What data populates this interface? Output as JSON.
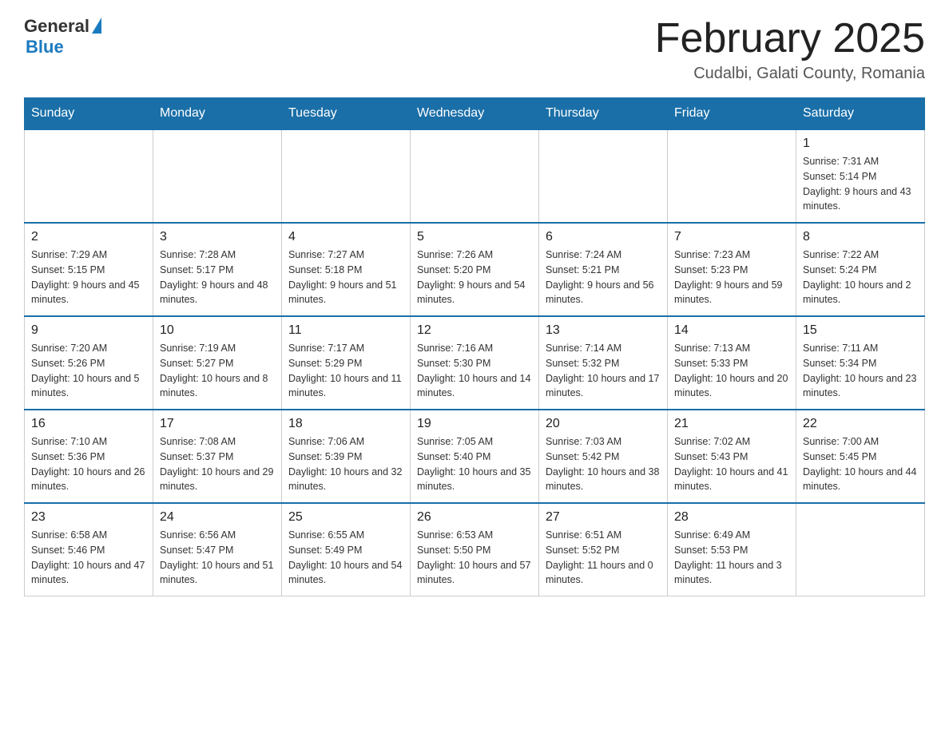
{
  "logo": {
    "general": "General",
    "blue": "Blue"
  },
  "title": "February 2025",
  "location": "Cudalbi, Galati County, Romania",
  "days_of_week": [
    "Sunday",
    "Monday",
    "Tuesday",
    "Wednesday",
    "Thursday",
    "Friday",
    "Saturday"
  ],
  "weeks": [
    {
      "days": [
        {
          "date": "",
          "empty": true
        },
        {
          "date": "",
          "empty": true
        },
        {
          "date": "",
          "empty": true
        },
        {
          "date": "",
          "empty": true
        },
        {
          "date": "",
          "empty": true
        },
        {
          "date": "",
          "empty": true
        },
        {
          "date": "1",
          "sunrise": "Sunrise: 7:31 AM",
          "sunset": "Sunset: 5:14 PM",
          "daylight": "Daylight: 9 hours and 43 minutes."
        }
      ]
    },
    {
      "days": [
        {
          "date": "2",
          "sunrise": "Sunrise: 7:29 AM",
          "sunset": "Sunset: 5:15 PM",
          "daylight": "Daylight: 9 hours and 45 minutes."
        },
        {
          "date": "3",
          "sunrise": "Sunrise: 7:28 AM",
          "sunset": "Sunset: 5:17 PM",
          "daylight": "Daylight: 9 hours and 48 minutes."
        },
        {
          "date": "4",
          "sunrise": "Sunrise: 7:27 AM",
          "sunset": "Sunset: 5:18 PM",
          "daylight": "Daylight: 9 hours and 51 minutes."
        },
        {
          "date": "5",
          "sunrise": "Sunrise: 7:26 AM",
          "sunset": "Sunset: 5:20 PM",
          "daylight": "Daylight: 9 hours and 54 minutes."
        },
        {
          "date": "6",
          "sunrise": "Sunrise: 7:24 AM",
          "sunset": "Sunset: 5:21 PM",
          "daylight": "Daylight: 9 hours and 56 minutes."
        },
        {
          "date": "7",
          "sunrise": "Sunrise: 7:23 AM",
          "sunset": "Sunset: 5:23 PM",
          "daylight": "Daylight: 9 hours and 59 minutes."
        },
        {
          "date": "8",
          "sunrise": "Sunrise: 7:22 AM",
          "sunset": "Sunset: 5:24 PM",
          "daylight": "Daylight: 10 hours and 2 minutes."
        }
      ]
    },
    {
      "days": [
        {
          "date": "9",
          "sunrise": "Sunrise: 7:20 AM",
          "sunset": "Sunset: 5:26 PM",
          "daylight": "Daylight: 10 hours and 5 minutes."
        },
        {
          "date": "10",
          "sunrise": "Sunrise: 7:19 AM",
          "sunset": "Sunset: 5:27 PM",
          "daylight": "Daylight: 10 hours and 8 minutes."
        },
        {
          "date": "11",
          "sunrise": "Sunrise: 7:17 AM",
          "sunset": "Sunset: 5:29 PM",
          "daylight": "Daylight: 10 hours and 11 minutes."
        },
        {
          "date": "12",
          "sunrise": "Sunrise: 7:16 AM",
          "sunset": "Sunset: 5:30 PM",
          "daylight": "Daylight: 10 hours and 14 minutes."
        },
        {
          "date": "13",
          "sunrise": "Sunrise: 7:14 AM",
          "sunset": "Sunset: 5:32 PM",
          "daylight": "Daylight: 10 hours and 17 minutes."
        },
        {
          "date": "14",
          "sunrise": "Sunrise: 7:13 AM",
          "sunset": "Sunset: 5:33 PM",
          "daylight": "Daylight: 10 hours and 20 minutes."
        },
        {
          "date": "15",
          "sunrise": "Sunrise: 7:11 AM",
          "sunset": "Sunset: 5:34 PM",
          "daylight": "Daylight: 10 hours and 23 minutes."
        }
      ]
    },
    {
      "days": [
        {
          "date": "16",
          "sunrise": "Sunrise: 7:10 AM",
          "sunset": "Sunset: 5:36 PM",
          "daylight": "Daylight: 10 hours and 26 minutes."
        },
        {
          "date": "17",
          "sunrise": "Sunrise: 7:08 AM",
          "sunset": "Sunset: 5:37 PM",
          "daylight": "Daylight: 10 hours and 29 minutes."
        },
        {
          "date": "18",
          "sunrise": "Sunrise: 7:06 AM",
          "sunset": "Sunset: 5:39 PM",
          "daylight": "Daylight: 10 hours and 32 minutes."
        },
        {
          "date": "19",
          "sunrise": "Sunrise: 7:05 AM",
          "sunset": "Sunset: 5:40 PM",
          "daylight": "Daylight: 10 hours and 35 minutes."
        },
        {
          "date": "20",
          "sunrise": "Sunrise: 7:03 AM",
          "sunset": "Sunset: 5:42 PM",
          "daylight": "Daylight: 10 hours and 38 minutes."
        },
        {
          "date": "21",
          "sunrise": "Sunrise: 7:02 AM",
          "sunset": "Sunset: 5:43 PM",
          "daylight": "Daylight: 10 hours and 41 minutes."
        },
        {
          "date": "22",
          "sunrise": "Sunrise: 7:00 AM",
          "sunset": "Sunset: 5:45 PM",
          "daylight": "Daylight: 10 hours and 44 minutes."
        }
      ]
    },
    {
      "days": [
        {
          "date": "23",
          "sunrise": "Sunrise: 6:58 AM",
          "sunset": "Sunset: 5:46 PM",
          "daylight": "Daylight: 10 hours and 47 minutes."
        },
        {
          "date": "24",
          "sunrise": "Sunrise: 6:56 AM",
          "sunset": "Sunset: 5:47 PM",
          "daylight": "Daylight: 10 hours and 51 minutes."
        },
        {
          "date": "25",
          "sunrise": "Sunrise: 6:55 AM",
          "sunset": "Sunset: 5:49 PM",
          "daylight": "Daylight: 10 hours and 54 minutes."
        },
        {
          "date": "26",
          "sunrise": "Sunrise: 6:53 AM",
          "sunset": "Sunset: 5:50 PM",
          "daylight": "Daylight: 10 hours and 57 minutes."
        },
        {
          "date": "27",
          "sunrise": "Sunrise: 6:51 AM",
          "sunset": "Sunset: 5:52 PM",
          "daylight": "Daylight: 11 hours and 0 minutes."
        },
        {
          "date": "28",
          "sunrise": "Sunrise: 6:49 AM",
          "sunset": "Sunset: 5:53 PM",
          "daylight": "Daylight: 11 hours and 3 minutes."
        },
        {
          "date": "",
          "empty": true
        }
      ]
    }
  ]
}
